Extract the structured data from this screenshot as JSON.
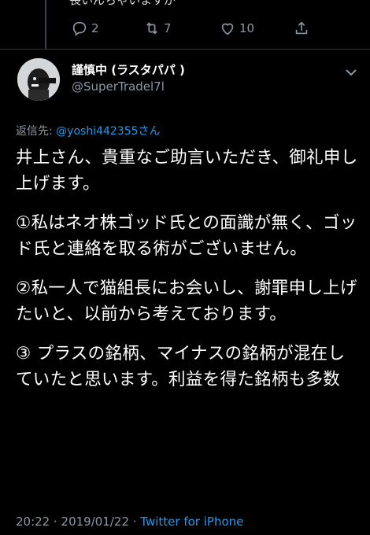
{
  "previous_tweet": {
    "text_fragment": "長いんちゃいますが",
    "reply_count": "2",
    "retweet_count": "7",
    "like_count": "10"
  },
  "tweet": {
    "display_name": "謹慎中 (ラスタパパ )",
    "handle": "@SuperTradel7l",
    "reply_prefix": "返信先: ",
    "reply_mention": "@yoshi442355さん",
    "paragraphs": [
      "井上さん、貴重なご助言いただき、御礼申し上げます。",
      "①私はネオ株ゴッド氏との面識が無く、ゴッド氏と連絡を取る術がございません。",
      "②私一人で猫組長にお会いし、謝罪申し上げたいと、以前から考えております。",
      "③ プラスの銘柄、マイナスの銘柄が混在していたと思います。利益を得た銘柄も多数"
    ],
    "timestamp": "20:22 · 2019/01/22 · ",
    "client": "Twitter for iPhone"
  },
  "icons": [
    "reply-icon",
    "retweet-icon",
    "like-icon",
    "share-icon",
    "chevron-down-icon"
  ],
  "colors": {
    "background": "#000000",
    "text": "#ffffff",
    "secondary": "#8b98a5",
    "link": "#1d9bf0"
  }
}
